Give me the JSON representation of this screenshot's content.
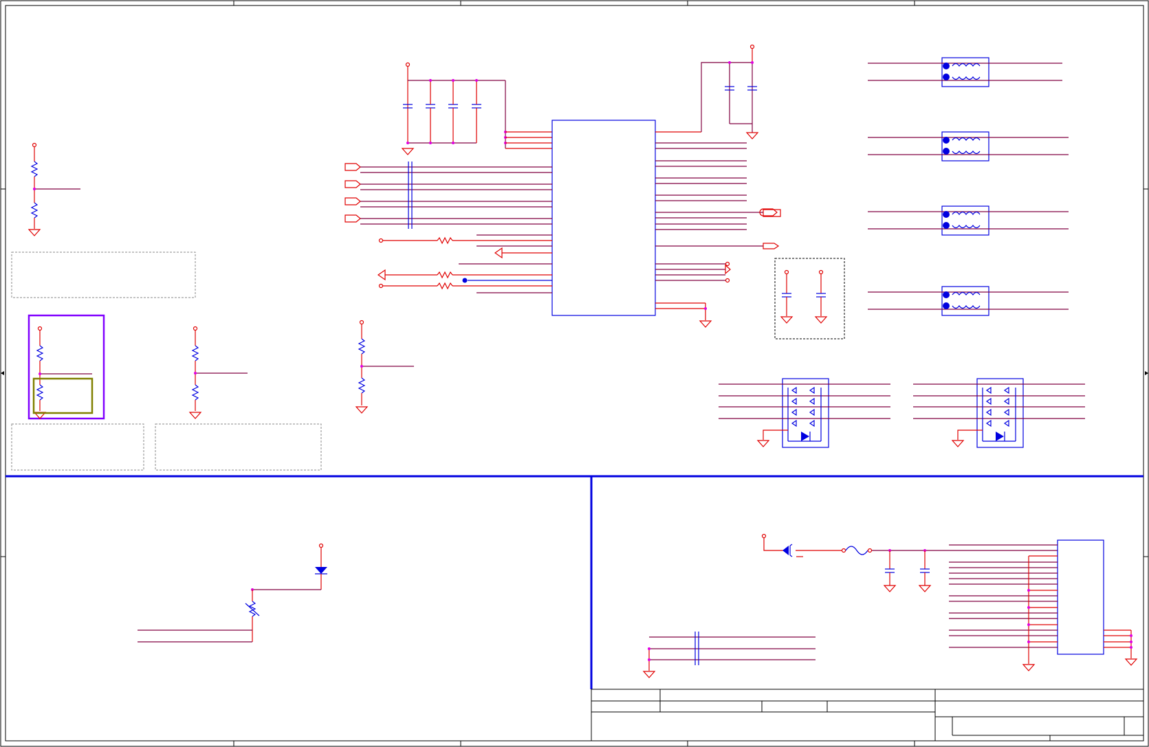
{
  "colors": {
    "wire": "#800040",
    "pin": "#e00000",
    "component": "#0000e0",
    "junction": "#e000e0",
    "highlight_box": "#8000ff",
    "selection_box": "#808000"
  }
}
